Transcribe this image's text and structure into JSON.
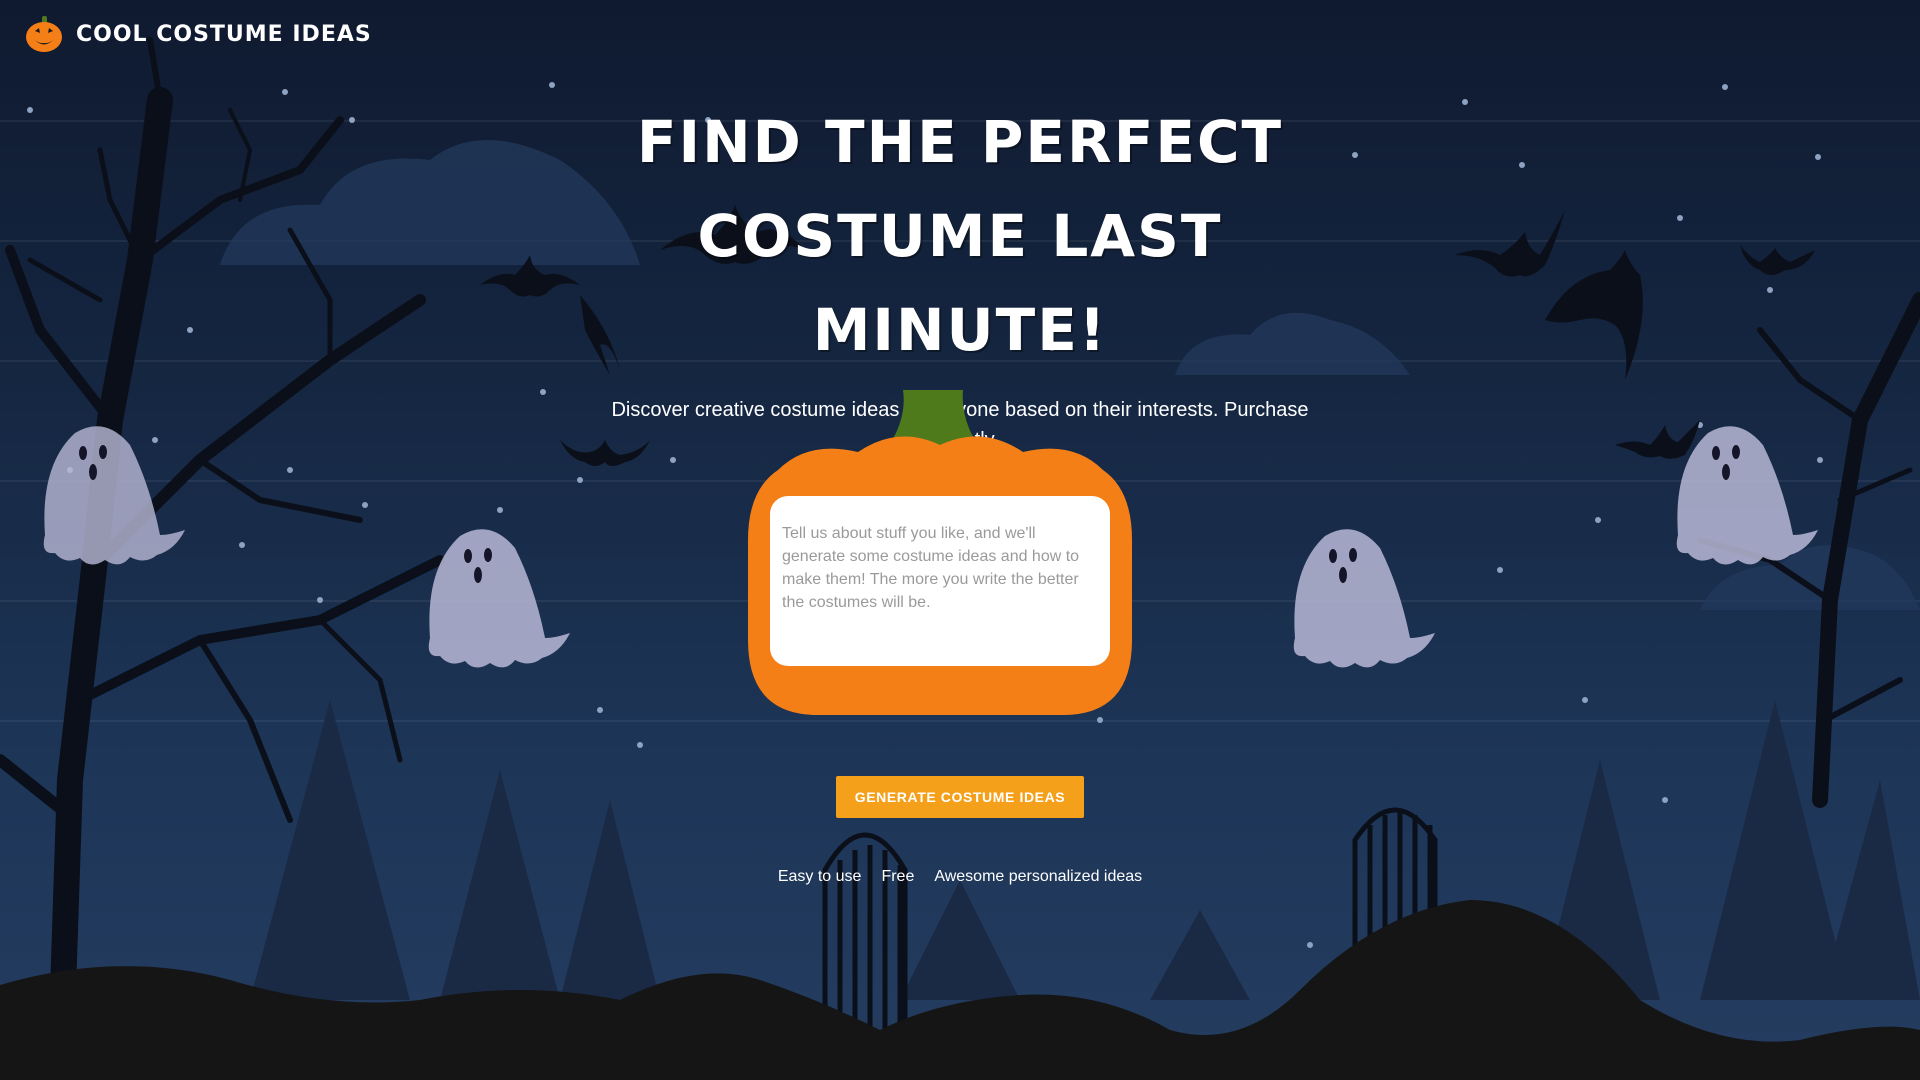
{
  "header": {
    "logo_icon": "jack-o-lantern-icon",
    "logo_text": "Cool Costume Ideas"
  },
  "hero": {
    "title_line1": "Find the Perfect",
    "title_line2": "Costume Last Minute!",
    "subtitle": "Discover creative costume ideas for anyone based on their interests. Purchase instantly."
  },
  "form": {
    "placeholder": "Tell us about stuff you like, and we'll generate some costume ideas and how to make them! The more you write the better the costumes will be.",
    "value": "",
    "button_label": "GENERATE COSTUME IDEAS"
  },
  "features": [
    "Easy to use",
    "Free",
    "Awesome personalized ideas"
  ],
  "colors": {
    "background": "#152641",
    "pumpkin": "#f57f17",
    "stem": "#4e7a1c",
    "button": "#f5a01a",
    "ghost": "#b9b9d6",
    "ground": "#151515"
  }
}
